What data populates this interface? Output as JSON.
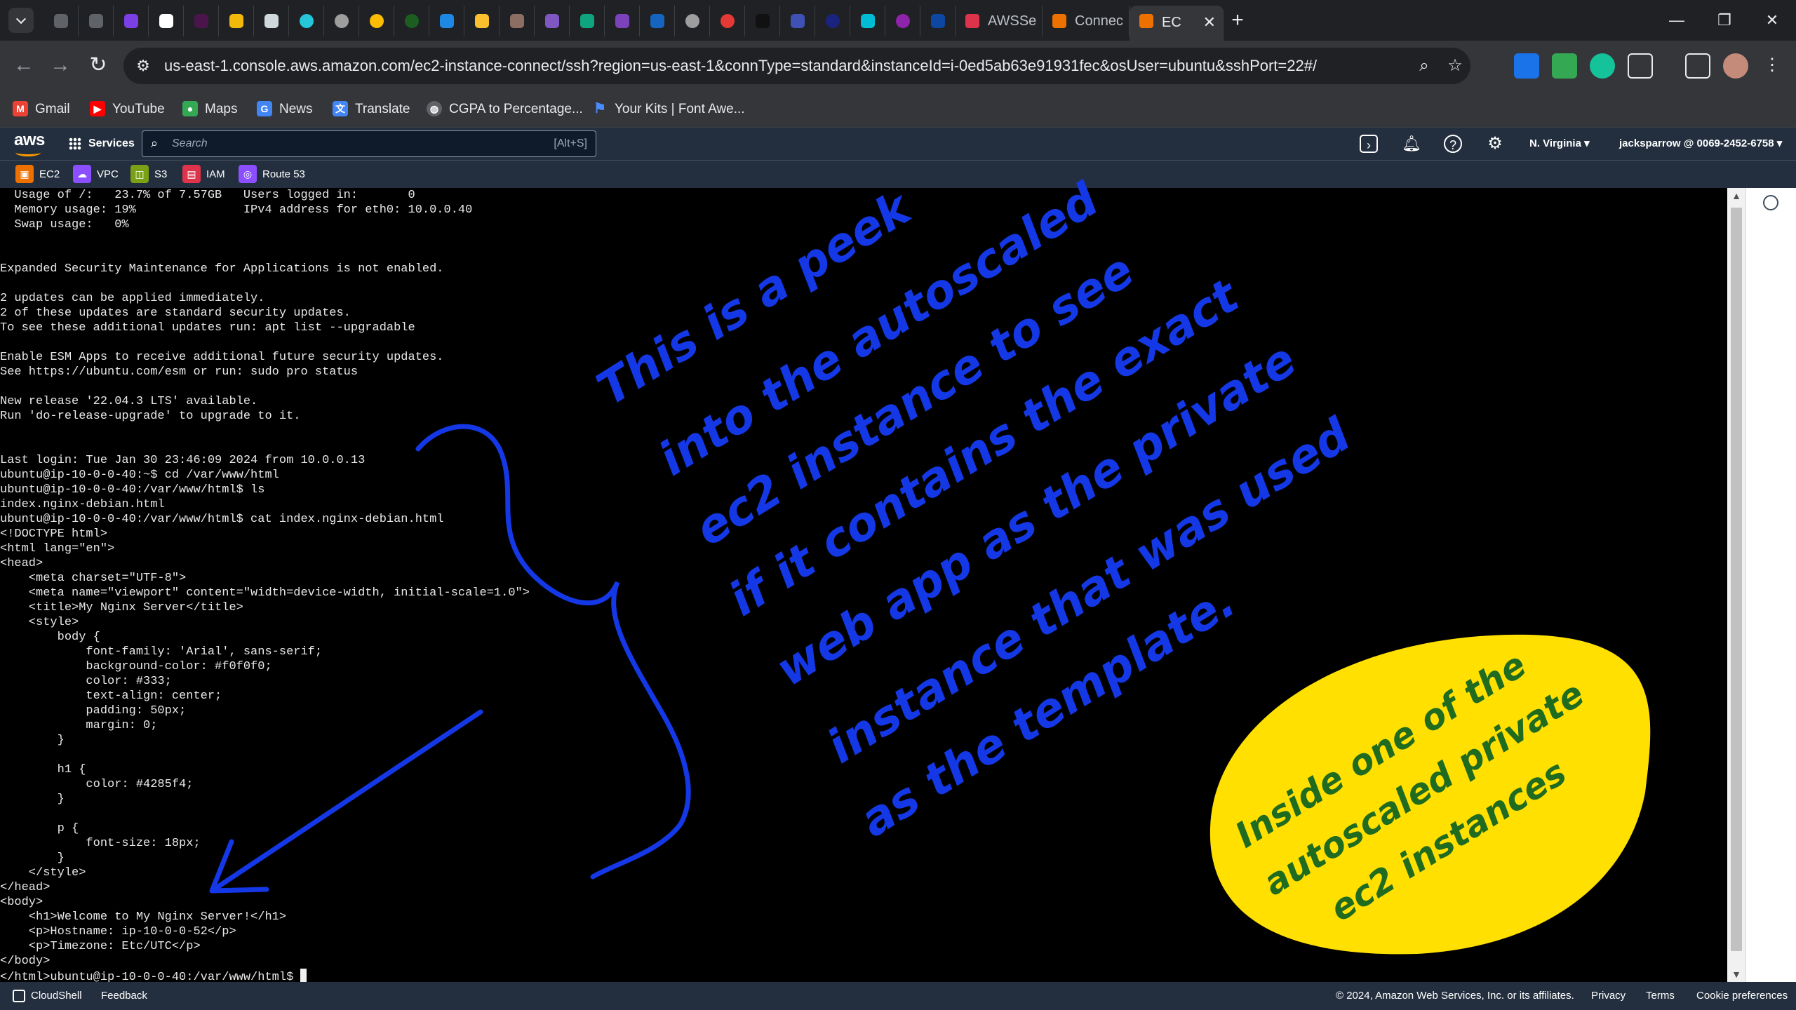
{
  "browser": {
    "tabs": [
      {
        "label": "AWSSe",
        "color": "#dd344c"
      },
      {
        "label": "Connec",
        "color": "#ed7100"
      },
      {
        "label": "EC",
        "color": "#ed7100"
      }
    ],
    "url": "us-east-1.console.aws.amazon.com/ec2-instance-connect/ssh?region=us-east-1&connType=standard&instanceId=i-0ed5ab63e91931fec&osUser=ubuntu&sshPort=22#/",
    "bookmarks": [
      {
        "label": "Gmail",
        "icon": "gmail-icon",
        "color": "#ea4335",
        "glyph": "M"
      },
      {
        "label": "YouTube",
        "icon": "youtube-icon",
        "color": "#ff0000",
        "glyph": "▶"
      },
      {
        "label": "Maps",
        "icon": "maps-icon",
        "color": "#34a853",
        "glyph": "●"
      },
      {
        "label": "News",
        "icon": "news-icon",
        "color": "#4285f4",
        "glyph": "G"
      },
      {
        "label": "Translate",
        "icon": "translate-icon",
        "color": "#4285f4",
        "glyph": "文"
      },
      {
        "label": "CGPA to Percentage...",
        "icon": "globe-icon",
        "color": "#5f6368",
        "glyph": "◍"
      },
      {
        "label": "Your Kits | Font Awe...",
        "icon": "flag-icon",
        "color": "#4a8cff",
        "glyph": "⚑"
      }
    ]
  },
  "aws": {
    "services_label": "Services",
    "search_placeholder": "Search",
    "search_shortcut": "[Alt+S]",
    "region": "N. Virginia ▾",
    "account": "jacksparrow @ 0069-2452-6758 ▾",
    "favorites": [
      {
        "label": "EC2",
        "color": "#ed7100",
        "icon": "ec2-icon"
      },
      {
        "label": "VPC",
        "color": "#8c4fff",
        "icon": "vpc-icon"
      },
      {
        "label": "S3",
        "color": "#7aa116",
        "icon": "s3-icon"
      },
      {
        "label": "IAM",
        "color": "#dd344c",
        "icon": "iam-icon"
      },
      {
        "label": "Route 53",
        "color": "#8c4fff",
        "icon": "route53-icon"
      }
    ]
  },
  "terminal": {
    "lines": [
      "  Usage of /:   23.7% of 7.57GB   Users logged in:       0",
      "  Memory usage: 19%               IPv4 address for eth0: 10.0.0.40",
      "  Swap usage:   0%",
      "",
      "",
      "Expanded Security Maintenance for Applications is not enabled.",
      "",
      "2 updates can be applied immediately.",
      "2 of these updates are standard security updates.",
      "To see these additional updates run: apt list --upgradable",
      "",
      "Enable ESM Apps to receive additional future security updates.",
      "See https://ubuntu.com/esm or run: sudo pro status",
      "",
      "New release '22.04.3 LTS' available.",
      "Run 'do-release-upgrade' to upgrade to it.",
      "",
      "",
      "Last login: Tue Jan 30 23:46:09 2024 from 10.0.0.13",
      "ubuntu@ip-10-0-0-40:~$ cd /var/www/html",
      "ubuntu@ip-10-0-0-40:/var/www/html$ ls",
      "index.nginx-debian.html",
      "ubuntu@ip-10-0-0-40:/var/www/html$ cat index.nginx-debian.html",
      "<!DOCTYPE html>",
      "<html lang=\"en\">",
      "<head>",
      "    <meta charset=\"UTF-8\">",
      "    <meta name=\"viewport\" content=\"width=device-width, initial-scale=1.0\">",
      "    <title>My Nginx Server</title>",
      "    <style>",
      "        body {",
      "            font-family: 'Arial', sans-serif;",
      "            background-color: #f0f0f0;",
      "            color: #333;",
      "            text-align: center;",
      "            padding: 50px;",
      "            margin: 0;",
      "        }",
      "",
      "        h1 {",
      "            color: #4285f4;",
      "        }",
      "",
      "        p {",
      "            font-size: 18px;",
      "        }",
      "    </style>",
      "</head>",
      "<body>",
      "    <h1>Welcome to My Nginx Server!</h1>",
      "    <p>Hostname: ip-10-0-0-52</p>",
      "    <p>Timezone: Etc/UTC</p>",
      "</body>"
    ],
    "prompt_line": "</html>ubuntu@ip-10-0-0-40:/var/www/html$ "
  },
  "annotations": {
    "blue_note": [
      "This is a peek",
      "into the autoscaled",
      "ec2 instance to see",
      "if it contains the exact",
      "web app as the private",
      "instance that was used",
      "as the template."
    ],
    "yellow_note": [
      "Inside one of the",
      "autoscaled private",
      "ec2 instances"
    ],
    "blue_color": "#1438e6",
    "yellow_color": "#ffe000",
    "yellow_text_color": "#1f6b1f"
  },
  "footer": {
    "cloudshell": "CloudShell",
    "feedback": "Feedback",
    "copyright": "© 2024, Amazon Web Services, Inc. or its affiliates.",
    "privacy": "Privacy",
    "terms": "Terms",
    "cookies": "Cookie preferences"
  }
}
